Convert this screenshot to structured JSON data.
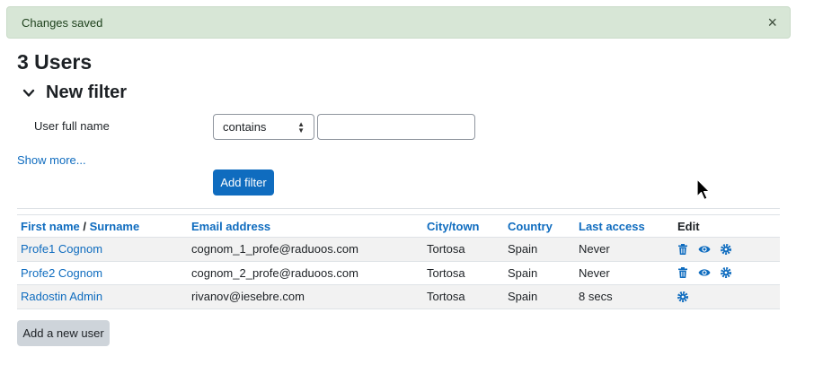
{
  "alert": {
    "message": "Changes saved",
    "close_glyph": "×"
  },
  "heading": "3 Users",
  "filter": {
    "title": "New filter",
    "field_label": "User full name",
    "operator_selected": "contains",
    "value": "",
    "show_more": "Show more...",
    "add_filter_label": "Add filter"
  },
  "table": {
    "col_first_name": "First name",
    "col_sep": " / ",
    "col_surname": "Surname",
    "col_email": "Email address",
    "col_city": "City/town",
    "col_country": "Country",
    "col_last_access": "Last access",
    "col_edit": "Edit",
    "rows": [
      {
        "name": "Profe1 Cognom",
        "email": "cognom_1_profe@raduoos.com",
        "city": "Tortosa",
        "country": "Spain",
        "last_access": "Never",
        "actions": [
          "trash-icon",
          "eye-icon",
          "gear-icon"
        ]
      },
      {
        "name": "Profe2 Cognom",
        "email": "cognom_2_profe@raduoos.com",
        "city": "Tortosa",
        "country": "Spain",
        "last_access": "Never",
        "actions": [
          "trash-icon",
          "eye-icon",
          "gear-icon"
        ]
      },
      {
        "name": "Radostin Admin",
        "email": "rivanov@iesebre.com",
        "city": "Tortosa",
        "country": "Spain",
        "last_access": "8 secs",
        "actions": [
          "gear-icon"
        ]
      }
    ]
  },
  "add_user_label": "Add a new user",
  "colors": {
    "link": "#0f6cbf",
    "success_bg": "#d7e6d6",
    "primary_button": "#0f6cbf",
    "secondary_button": "#ced4da"
  }
}
